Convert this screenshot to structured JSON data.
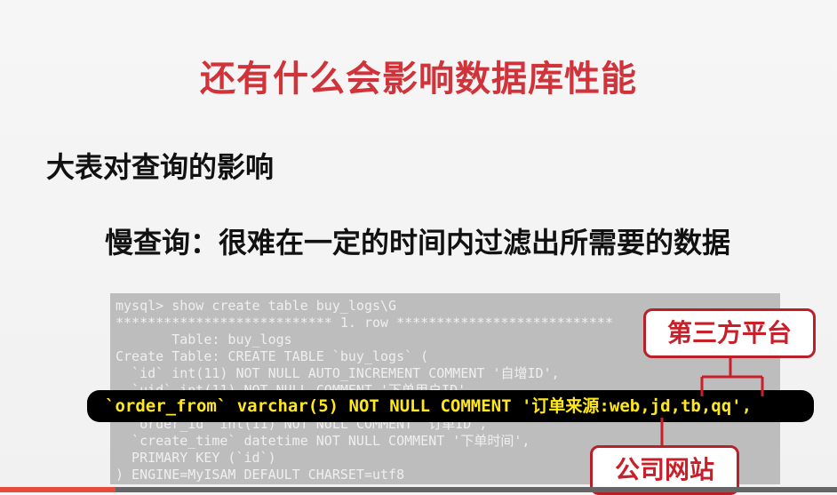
{
  "slide": {
    "title": "还有什么会影响数据库性能",
    "subtitle": "大表对查询的影响",
    "point": "慢查询：很难在一定的时间内过滤出所需要的数据"
  },
  "terminal": {
    "lines": [
      "mysql> show create table buy_logs\\G",
      "*************************** 1. row ***************************",
      "       Table: buy_logs",
      "Create Table: CREATE TABLE `buy_logs` (",
      "  `id` int(11) NOT NULL AUTO_INCREMENT COMMENT '自增ID',",
      "  `uid` int(11) NOT NULL COMMENT '下单用户ID',",
      "",
      "  `order_id` int(11) NOT NULL COMMENT '订单ID',",
      "  `create_time` datetime NOT NULL COMMENT '下单时间',",
      "  PRIMARY KEY (`id`)",
      ") ENGINE=MyISAM DEFAULT CHARSET=utf8"
    ],
    "highlighted_line": "`order_from` varchar(5) NOT NULL COMMENT '订单来源:web,jd,tb,qq',"
  },
  "callouts": {
    "top": "第三方平台",
    "bottom": "公司网站"
  },
  "colors": {
    "title": "#d0343a",
    "highlight_text": "#ffe81a",
    "callout_border": "#b8202a"
  }
}
